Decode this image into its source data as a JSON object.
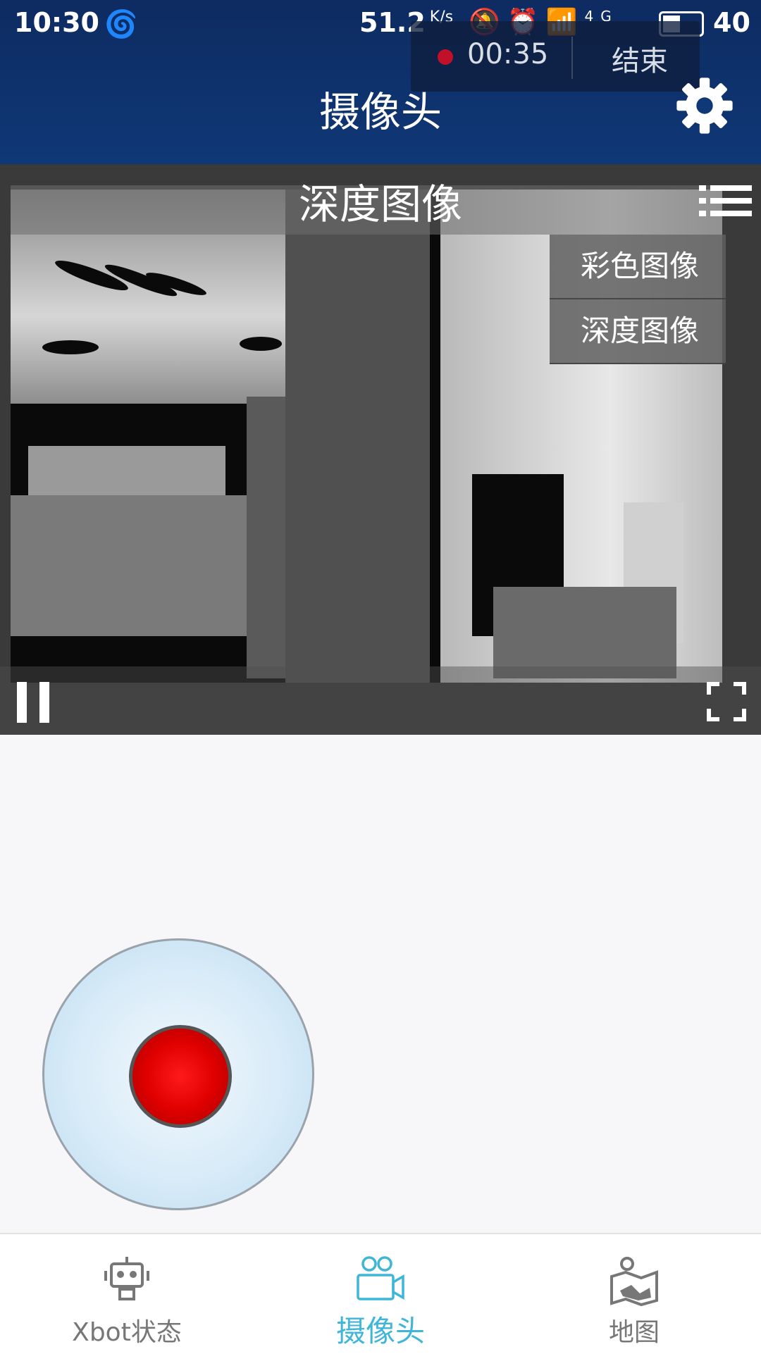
{
  "status_bar": {
    "time": "10:30",
    "speed": "51.2",
    "speed_unit": "K/s",
    "signal_label": "4G",
    "battery_level": "40"
  },
  "recording": {
    "time": "00:35",
    "end_label": "结束",
    "dot_color": "#c0102a"
  },
  "header": {
    "title": "摄像头",
    "background_color": "#0f3876"
  },
  "video": {
    "title": "深度图像",
    "menu_items": [
      "彩色图像",
      "深度图像"
    ]
  },
  "joystick": {
    "knob_color": "#e00000"
  },
  "tabs": [
    {
      "label": "Xbot状态",
      "icon": "robot-icon",
      "active": false
    },
    {
      "label": "摄像头",
      "icon": "camera-icon",
      "active": true
    },
    {
      "label": "地图",
      "icon": "map-icon",
      "active": false
    }
  ],
  "accent_color": "#3fb6d8"
}
